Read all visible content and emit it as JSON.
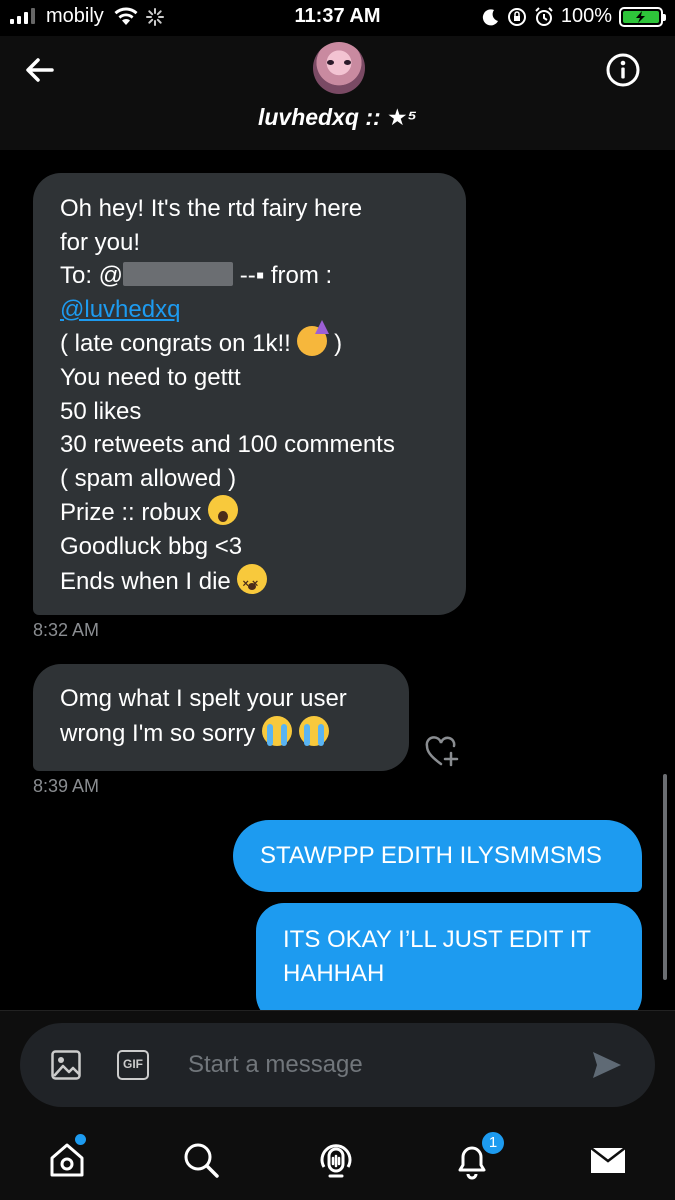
{
  "status_bar": {
    "carrier": "mobily",
    "time": "11:37 AM",
    "battery": "100%",
    "colors": {
      "battery_fill": "#2ec43a"
    }
  },
  "header": {
    "back_icon": "arrow-left-icon",
    "info_icon": "info-circle-icon",
    "chat_name": "luvhedxq :: ★⁵"
  },
  "messages": {
    "m1": {
      "line1": "Oh hey! It's the rtd fairy here",
      "line2": "for you!",
      "line3_prefix": "To: @",
      "line3_suffix": " --▪ from :",
      "link": "@luvhedxq",
      "line5": "( late congrats on 1k!! ",
      "line5_end": " )",
      "line6": "You need to gettt",
      "line7": "50 likes",
      "line8": "30 retweets and 100 comments",
      "line9": "( spam allowed )",
      "line10": "Prize :: robux ",
      "line11": "Goodluck bbg <3",
      "line12": "Ends when I die ",
      "timestamp": "8:32 AM"
    },
    "m2": {
      "line1": "Omg what I spelt your user",
      "line2": "wrong I'm so sorry ",
      "timestamp": "8:39 AM",
      "react_icon": "heart-plus-icon"
    },
    "o1": {
      "text": "STAWPPP EDITH ILYSMMSMS"
    },
    "o2": {
      "line1": "ITS OKAY I’LL JUST EDIT IT",
      "line2": "HAHHAH"
    }
  },
  "composer": {
    "placeholder": "Start a message",
    "gif_label": "GIF",
    "image_icon": "image-icon",
    "send_icon": "send-icon"
  },
  "tab_bar": {
    "tabs": [
      "home-icon",
      "search-icon",
      "spaces-icon",
      "bell-icon",
      "mail-icon"
    ],
    "notification_count": "1",
    "accent": "#1d9bf0"
  }
}
